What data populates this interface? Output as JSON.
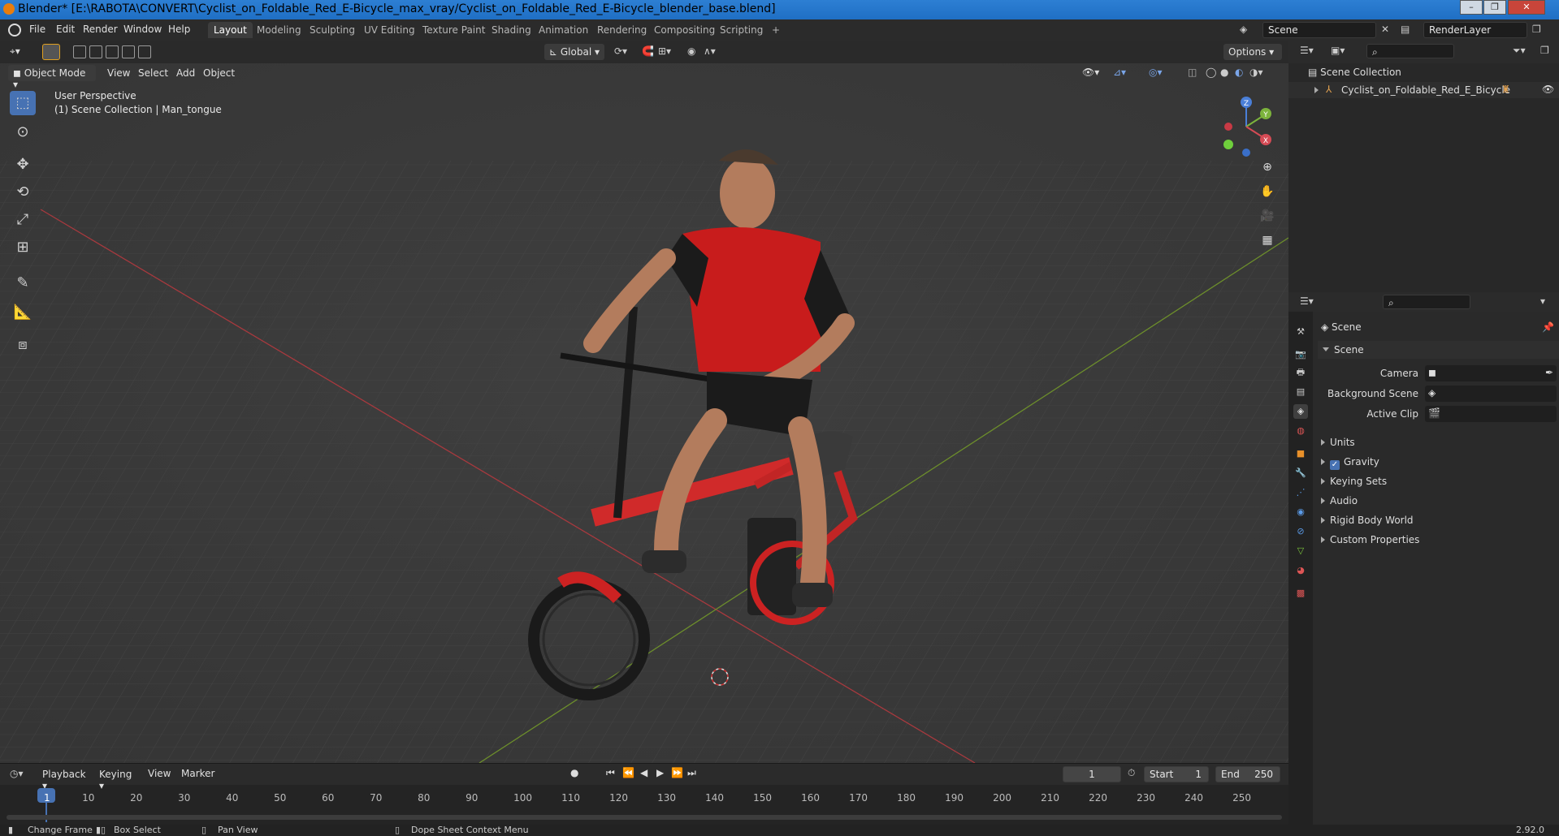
{
  "window": {
    "title": "Blender* [E:\\RABOTA\\CONVERT\\Cyclist_on_Foldable_Red_E-Bicycle_max_vray/Cyclist_on_Foldable_Red_E-Bicycle_blender_base.blend]"
  },
  "menubar": {
    "items": [
      "File",
      "Edit",
      "Render",
      "Window",
      "Help"
    ],
    "workspaces": [
      "Layout",
      "Modeling",
      "Sculpting",
      "UV Editing",
      "Texture Paint",
      "Shading",
      "Animation",
      "Rendering",
      "Compositing",
      "Scripting"
    ],
    "add_tab": "+",
    "scene": "Scene",
    "view_layer": "RenderLayer"
  },
  "viewport_header": {
    "mode": "Object Mode",
    "menus": [
      "View",
      "Select",
      "Add",
      "Object"
    ],
    "transform": "Global",
    "options": "Options"
  },
  "viewport": {
    "perspective": "User Perspective",
    "collection": "(1) Scene Collection | Man_tongue",
    "gizmo": {
      "z": "Z",
      "y": "Y",
      "x": "X"
    }
  },
  "outliner": {
    "root": "Scene Collection",
    "items": [
      "Cyclist_on_Foldable_Red_E_Bicycle"
    ]
  },
  "properties": {
    "context": "Scene",
    "panel": "Scene",
    "fields": [
      {
        "label": "Camera"
      },
      {
        "label": "Background Scene"
      },
      {
        "label": "Active Clip"
      }
    ],
    "subpanels": [
      "Units",
      "Gravity",
      "Keying Sets",
      "Audio",
      "Rigid Body World",
      "Custom Properties"
    ]
  },
  "timeline": {
    "menus": [
      "Playback",
      "Keying",
      "View",
      "Marker"
    ],
    "current_frame": "1",
    "start_label": "Start",
    "start": "1",
    "end_label": "End",
    "end": "250",
    "ticks": [
      "1",
      "10",
      "20",
      "30",
      "40",
      "50",
      "60",
      "70",
      "80",
      "90",
      "100",
      "110",
      "120",
      "130",
      "140",
      "150",
      "160",
      "170",
      "180",
      "190",
      "200",
      "210",
      "220",
      "230",
      "240",
      "250"
    ]
  },
  "statusbar": {
    "items": [
      "Change Frame",
      "Box Select",
      "Pan View",
      "Dope Sheet Context Menu"
    ],
    "version": "2.92.0"
  }
}
